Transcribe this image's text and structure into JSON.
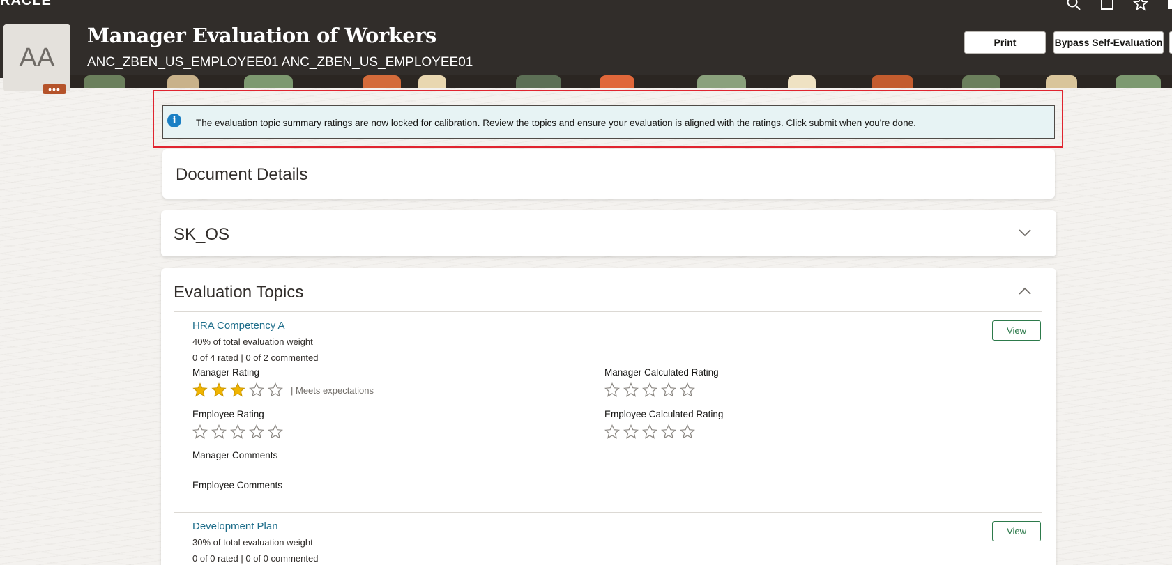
{
  "header": {
    "brand": "RACLE",
    "title": "Manager Evaluation of Workers",
    "subtitle": "ANC_ZBEN_US_EMPLOYEE01 ANC_ZBEN_US_EMPLOYEE01",
    "avatar_initials": "AA",
    "avatar_more": "•••",
    "buttons": {
      "print": "Print",
      "bypass": "Bypass Self-Evaluation"
    },
    "icons": [
      "search-icon",
      "home-icon",
      "favorite-icon"
    ]
  },
  "alert": {
    "icon": "info-icon",
    "message": "The evaluation topic summary ratings are now locked for calibration. Review the topics and ensure your evaluation is aligned with the ratings. Click submit when you're done."
  },
  "sections": {
    "document_details": "Document Details",
    "skos": "SK_OS",
    "evaluation_topics": "Evaluation Topics"
  },
  "topics": [
    {
      "name": "HRA Competency A",
      "weight": "40% of total evaluation weight",
      "progress": "0 of 4 rated | 0 of 2 commented",
      "view": "View",
      "manager_rating_label": "Manager Rating",
      "manager_rating_value": 3,
      "manager_rating_text": "| Meets expectations",
      "manager_calc_label": "Manager Calculated Rating",
      "employee_rating_label": "Employee Rating",
      "employee_calc_label": "Employee Calculated Rating",
      "manager_comments_label": "Manager Comments",
      "employee_comments_label": "Employee Comments"
    },
    {
      "name": "Development Plan",
      "weight": "30% of total evaluation weight",
      "progress": "0 of 0 rated | 0 of 0 commented",
      "view": "View"
    }
  ],
  "colors": {
    "header_bg": "#312d2a",
    "alert_bg": "#e7f3f4",
    "alert_outline": "#e0242f",
    "link": "#1d6d8a",
    "view_button": "#2d7a4b",
    "star_filled": "#f0b400"
  }
}
